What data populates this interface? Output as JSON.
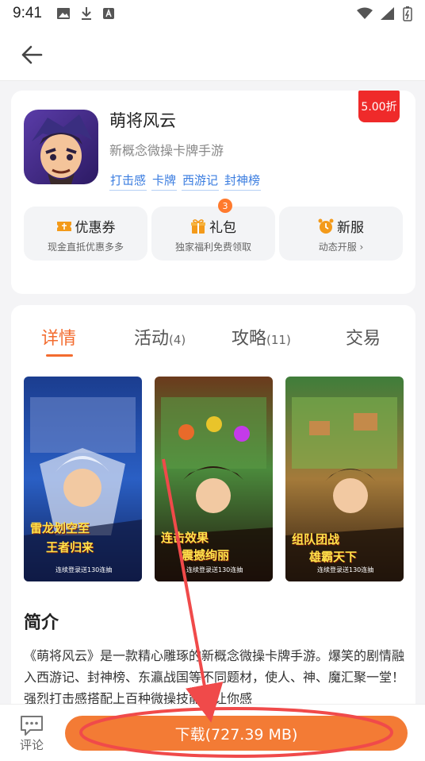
{
  "status_bar": {
    "time": "9:41"
  },
  "app": {
    "name": "萌将风云",
    "description": "新概念微操卡牌手游",
    "tags": [
      "打击感",
      "卡牌",
      "西游记",
      "封神榜"
    ],
    "discount": "5.00折"
  },
  "perks": [
    {
      "title": "优惠券",
      "subtitle": "现金直抵优惠多多"
    },
    {
      "title": "礼包",
      "subtitle": "独家福利免费领取",
      "badge": "3"
    },
    {
      "title": "新服",
      "subtitle": "动态开服 ›"
    }
  ],
  "tabs": [
    {
      "label": "详情",
      "count": ""
    },
    {
      "label": "活动",
      "count": "(4)"
    },
    {
      "label": "攻略",
      "count": "(11)"
    },
    {
      "label": "交易",
      "count": ""
    }
  ],
  "screenshots": [
    {
      "line1": "雷龙划空至",
      "line2": "王者归来",
      "footer": "连续登录送130连抽"
    },
    {
      "line1": "连击效果",
      "line2": "震撼绚丽",
      "footer": "连续登录送130连抽"
    },
    {
      "line1": "组队团战",
      "line2": "雄霸天下",
      "footer": "连续登录送130连抽"
    }
  ],
  "intro": {
    "title": "简介",
    "text": "《萌将风云》是一款精心雕琢的新概念微操卡牌手游。爆笑的剧情融入西游记、封神榜、东瀛战国等不同题材，使人、神、魔汇聚一堂！强烈打击感搭配上百种微操技能，让你感"
  },
  "bottom": {
    "comment_label": "评论",
    "download_label": "下载(727.39 MB)"
  },
  "colors": {
    "accent": "#f36c2f",
    "download": "#f37b35",
    "discount": "#ef2a2a",
    "tag": "#3b7de0",
    "annotation": "#f04a4a"
  }
}
